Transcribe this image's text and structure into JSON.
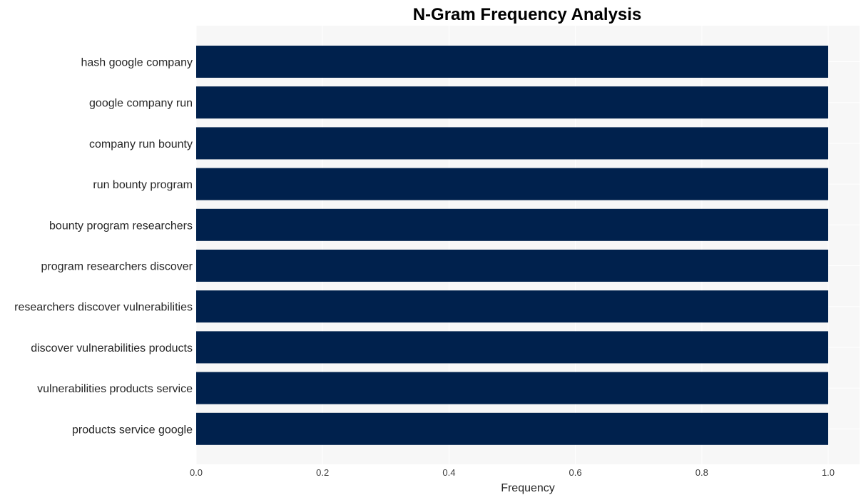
{
  "chart_data": {
    "type": "bar",
    "orientation": "horizontal",
    "title": "N-Gram Frequency Analysis",
    "xlabel": "Frequency",
    "ylabel": "",
    "categories": [
      "hash google company",
      "google company run",
      "company run bounty",
      "run bounty program",
      "bounty program researchers",
      "program researchers discover",
      "researchers discover vulnerabilities",
      "discover vulnerabilities products",
      "vulnerabilities products service",
      "products service google"
    ],
    "values": [
      1,
      1,
      1,
      1,
      1,
      1,
      1,
      1,
      1,
      1
    ],
    "xlim": [
      0,
      1.05
    ],
    "xticks": [
      0.0,
      0.2,
      0.4,
      0.6,
      0.8,
      1.0
    ],
    "xtick_labels": [
      "0.0",
      "0.2",
      "0.4",
      "0.6",
      "0.8",
      "1.0"
    ],
    "grid": true,
    "legend": "none",
    "colors": {
      "bar": "#00214d",
      "plot_background": "#f7f7f7",
      "grid": "#ffffff"
    }
  }
}
